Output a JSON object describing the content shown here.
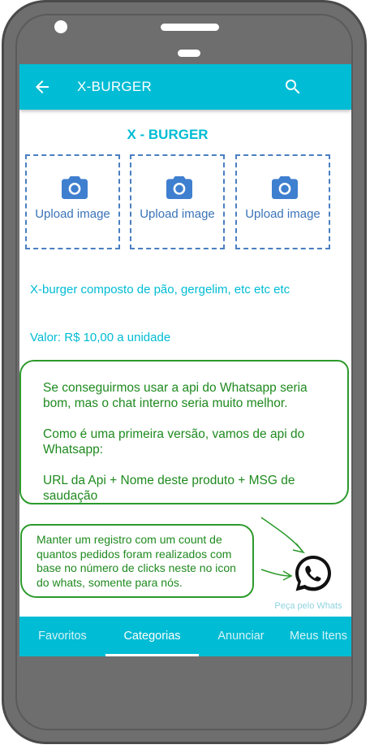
{
  "appbar": {
    "title": "X-BURGER",
    "back_icon": "arrow-back-icon",
    "search_icon": "search-icon"
  },
  "product": {
    "title": "X - BURGER",
    "description": "X-burger composto de pão, gergelim, etc etc etc",
    "price": "Valor: R$ 10,00 a unidade"
  },
  "uploads": [
    {
      "label": "Upload image",
      "icon": "camera-icon"
    },
    {
      "label": "Upload image",
      "icon": "camera-icon"
    },
    {
      "label": "Upload image",
      "icon": "camera-icon"
    }
  ],
  "notes": {
    "note1": {
      "line1": "Se conseguirmos usar a api do Whatsapp seria bom, mas o chat interno seria muito melhor.",
      "line2": "Como é uma primeira versão, vamos de api do Whatsapp:",
      "line3": "URL da Api + Nome deste produto + MSG de saudação"
    },
    "note2": "Manter um registro com um count de quantos pedidos foram realizados com base no número de clicks neste no icon do whats, somente para nós."
  },
  "whatsapp": {
    "label": "Peça pelo Whats",
    "icon": "whatsapp-icon"
  },
  "bottom_nav": {
    "items": [
      "Favoritos",
      "Categorias",
      "Anunciar",
      "Meus Itens"
    ],
    "active": "Categorias"
  },
  "colors": {
    "primary": "#00bcd4",
    "annotation": "#2c9a2c",
    "upload_accent": "#4a7fc1",
    "device": "#6e6e6e"
  }
}
